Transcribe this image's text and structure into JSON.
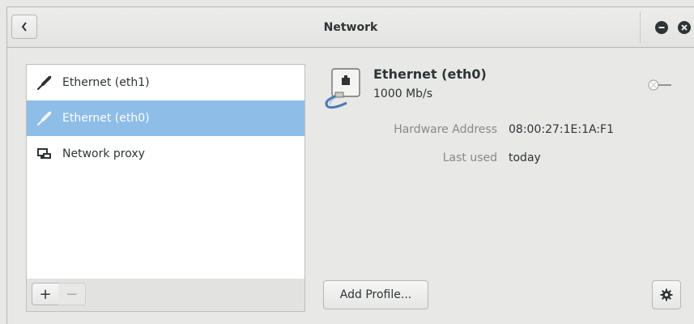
{
  "window": {
    "title": "Network"
  },
  "header": {
    "back_icon": "chevron-left-icon",
    "minimize_icon": "minimize-icon",
    "close_icon": "close-icon"
  },
  "sidebar": {
    "items": [
      {
        "label": "Ethernet (eth1)",
        "icon": "ethernet-cable-icon",
        "selected": false
      },
      {
        "label": "Ethernet (eth0)",
        "icon": "ethernet-cable-icon",
        "selected": true
      },
      {
        "label": "Network proxy",
        "icon": "network-proxy-icon",
        "selected": false
      }
    ],
    "add_label": "+",
    "remove_label": "−"
  },
  "device": {
    "name": "Ethernet (eth0)",
    "speed": "1000 Mb/s",
    "icon": "wired-network-icon",
    "connection_switch_icon": "network-switch-off-icon"
  },
  "details": [
    {
      "key": "Hardware Address",
      "value": "08:00:27:1E:1A:F1"
    },
    {
      "key": "Last used",
      "value": "today"
    }
  ],
  "actions": {
    "add_profile_label": "Add Profile...",
    "settings_icon": "gear-icon"
  },
  "colors": {
    "selection": "#8ebde8",
    "text": "#2e3436",
    "dim_text": "#888a85",
    "window_bg": "#e8e8e7"
  }
}
